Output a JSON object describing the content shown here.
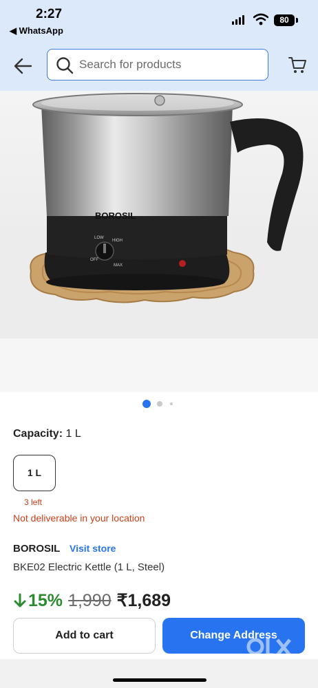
{
  "status_bar": {
    "time": "2:27",
    "back_app": "◀ WhatsApp",
    "battery": "80"
  },
  "header": {
    "search_placeholder": "Search for products"
  },
  "product_image": {
    "brand_on_kettle": "BOROSIL",
    "dial_labels": [
      "LOW",
      "HIGH",
      "OFF",
      "MAX"
    ]
  },
  "carousel": {
    "total": 3,
    "active": 1
  },
  "capacity": {
    "label": "Capacity:",
    "value": "1 L",
    "options": [
      "1 L"
    ]
  },
  "stock": {
    "left_text": "3 left"
  },
  "delivery": {
    "message": "Not deliverable in your location"
  },
  "product": {
    "brand": "BOROSIL",
    "visit_store": "Visit store",
    "name": "BKE02 Electric Kettle (1 L, Steel)"
  },
  "pricing": {
    "discount": "15%",
    "mrp": "1,990",
    "price": "₹1,689"
  },
  "actions": {
    "add_to_cart": "Add to cart",
    "change_address": "Change Address"
  },
  "watermark": {
    "text": "OLX"
  },
  "colors": {
    "accent": "#2874f0",
    "header_bg": "#dce9fb",
    "discount": "#2a8c2f",
    "warning": "#c9401a"
  }
}
